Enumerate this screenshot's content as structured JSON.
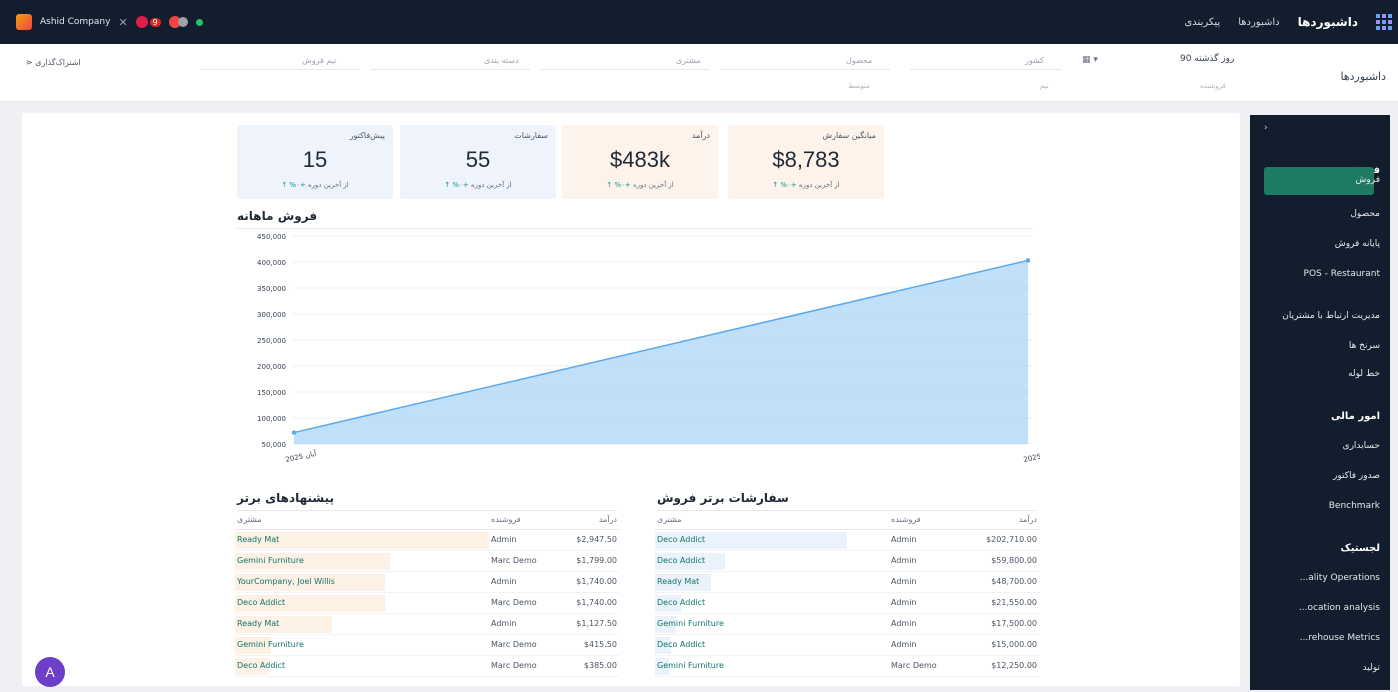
{
  "topbar": {
    "company": "Ashid Company",
    "brand": "داشبوردها",
    "nav": [
      "داشبوردها",
      "پیکربندی"
    ],
    "badge_count": "9"
  },
  "control": {
    "title": "داشبوردها",
    "share": "اشتراک‌گذاری",
    "period": "90 روز گذشته",
    "period_sub": "فروشنده",
    "date_icon": "calendar-icon",
    "filters": [
      {
        "label": "کشور",
        "sub": "تیم"
      },
      {
        "label": "محصول",
        "sub": "متوسط"
      },
      {
        "label": "مشتری",
        "sub": ""
      },
      {
        "label": "دسته بندی",
        "sub": ""
      },
      {
        "label": "تیم فروش",
        "sub": ""
      }
    ]
  },
  "kpis": [
    {
      "label": "میانگین سفارش",
      "value": "$8,783",
      "trend": "+۰%",
      "trend_text": "از آخرین دوره"
    },
    {
      "label": "درآمد",
      "value": "$483k",
      "trend": "+۰%",
      "trend_text": "از آخرین دوره"
    },
    {
      "label": "سفارشات",
      "value": "55",
      "trend": "+۰%",
      "trend_text": "از آخرین دوره"
    },
    {
      "label": "پیش‌فاکتور",
      "value": "15",
      "trend": "+۰%",
      "trend_text": "از آخرین دوره"
    }
  ],
  "chart_title": "فروش ماهانه",
  "chart_data": {
    "type": "area",
    "title": "فروش ماهانه",
    "x": [
      "آبان 2025",
      "آذر 2025"
    ],
    "values": [
      72000,
      403000
    ],
    "ylim": [
      50000,
      450000
    ],
    "yticks": [
      "450,000",
      "400,000",
      "350,000",
      "300,000",
      "250,000",
      "200,000",
      "150,000",
      "100,000",
      "50,000"
    ],
    "ytick_values": [
      450000,
      400000,
      350000,
      300000,
      250000,
      200000,
      150000,
      100000,
      50000
    ],
    "color": "#b9dcf8",
    "line_color": "#5aa9ec",
    "grid": true
  },
  "top_orders": {
    "title": "سفارشات برتر فروش",
    "headers": [
      "مشتری",
      "فروشنده",
      "درآمد"
    ],
    "rows": [
      [
        "Deco Addict",
        "Admin",
        "$202,710.00",
        0.82
      ],
      [
        "Deco Addict",
        "Admin",
        "$59,800.00",
        0.3
      ],
      [
        "Ready Mat",
        "Admin",
        "$48,700.00",
        0.24
      ],
      [
        "Deco Addict",
        "Admin",
        "$21,550.00",
        0.11
      ],
      [
        "Gemini Furniture",
        "Admin",
        "$17,500.00",
        0.09
      ],
      [
        "Deco Addict",
        "Admin",
        "$15,000.00",
        0.07
      ],
      [
        "Gemini Furniture",
        "Marc Demo",
        "$12,250.00",
        0.06
      ]
    ]
  },
  "top_quotes": {
    "title": "پیشنهادهای برتر",
    "headers": [
      "مشتری",
      "فروشنده",
      "درآمد"
    ],
    "rows": [
      [
        "Ready Mat",
        "Admin",
        "$2,947.50",
        1.0
      ],
      [
        "Gemini Furniture",
        "Marc Demo",
        "$1,799.00",
        0.61
      ],
      [
        "YourCompany, Joel Willis",
        "Admin",
        "$1,740.00",
        0.59
      ],
      [
        "Deco Addict",
        "Marc Demo",
        "$1,740.00",
        0.59
      ],
      [
        "Ready Mat",
        "Admin",
        "$1,127.50",
        0.38
      ],
      [
        "Gemini Furniture",
        "Marc Demo",
        "$415.50",
        0.14
      ],
      [
        "Deco Addict",
        "Marc Demo",
        "$385.00",
        0.13
      ]
    ]
  },
  "sidebar": {
    "toggle": "›",
    "items": [
      {
        "label": "فروش",
        "kind": "head"
      },
      {
        "label": "فروش",
        "kind": "active"
      },
      {
        "label": "محصول",
        "kind": "item"
      },
      {
        "label": "پایانه فروش",
        "kind": "item"
      },
      {
        "label": "POS - Restaurant",
        "kind": "item"
      },
      {
        "label": "مدیریت ارتباط با مشتریان",
        "kind": "item"
      },
      {
        "label": "سرنخ ها",
        "kind": "item"
      },
      {
        "label": "خط لوله",
        "kind": "item"
      },
      {
        "label": "امور مالی",
        "kind": "head"
      },
      {
        "label": "حسابداری",
        "kind": "item"
      },
      {
        "label": "صدور فاکتور",
        "kind": "item"
      },
      {
        "label": "Benchmark",
        "kind": "item"
      },
      {
        "label": "لجستیک",
        "kind": "head"
      },
      {
        "label": "...ality Operations",
        "kind": "item"
      },
      {
        "label": "...ocation analysis",
        "kind": "item"
      },
      {
        "label": "...rehouse Metrics",
        "kind": "item"
      },
      {
        "label": "تولید",
        "kind": "item"
      }
    ]
  },
  "avatar": "A"
}
